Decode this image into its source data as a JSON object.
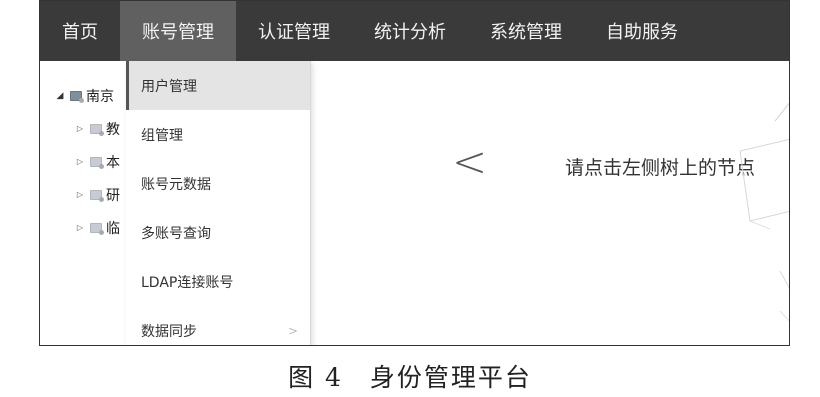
{
  "nav": {
    "items": [
      {
        "label": "首页",
        "active": false
      },
      {
        "label": "账号管理",
        "active": true
      },
      {
        "label": "认证管理",
        "active": false
      },
      {
        "label": "统计分析",
        "active": false
      },
      {
        "label": "系统管理",
        "active": false
      },
      {
        "label": "自助服务",
        "active": false
      }
    ]
  },
  "tree": {
    "root": {
      "label": "南京",
      "icon": "folder-icon",
      "expanded": true
    },
    "children": [
      {
        "label": "教",
        "icon": "folder-icon"
      },
      {
        "label": "本",
        "icon": "folder-icon"
      },
      {
        "label": "研",
        "icon": "folder-icon"
      },
      {
        "label": "临",
        "icon": "folder-icon"
      }
    ]
  },
  "dropdown": {
    "items": [
      {
        "label": "用户管理",
        "active": true
      },
      {
        "label": "组管理"
      },
      {
        "label": "账号元数据"
      },
      {
        "label": "多账号查询"
      },
      {
        "label": "LDAP连接账号"
      },
      {
        "label": "数据同步",
        "has_submenu": true
      }
    ]
  },
  "main": {
    "back_icon": "chevron-left-icon",
    "hint": "请点击左侧树上的节点"
  },
  "caption": "图 4　身份管理平台"
}
